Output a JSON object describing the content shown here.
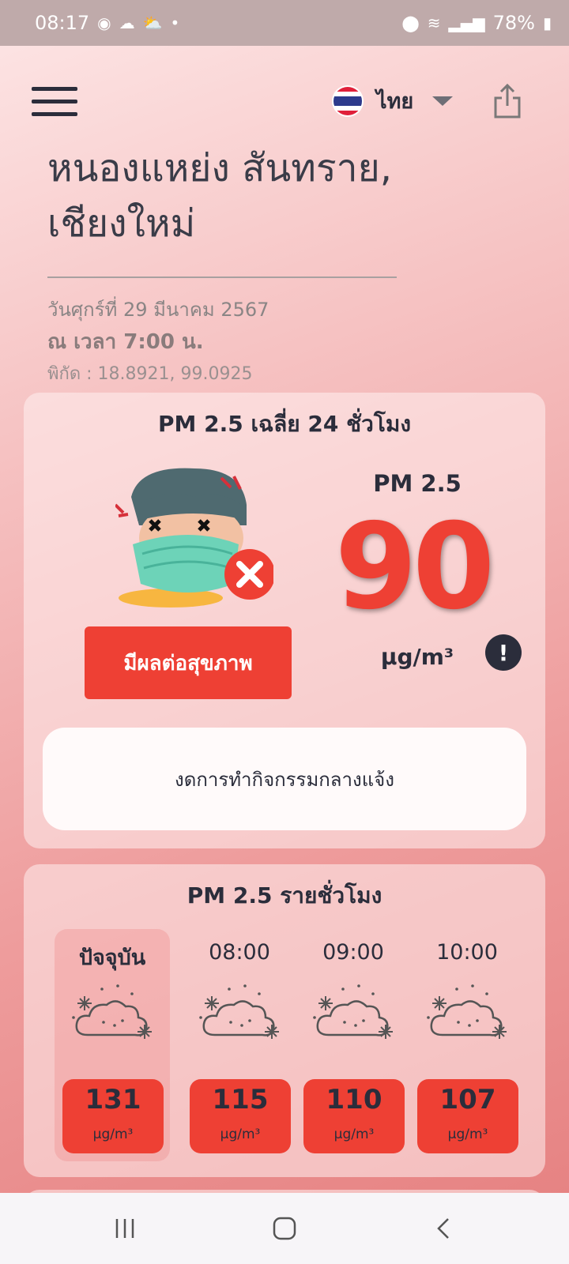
{
  "status_bar": {
    "time": "08:17",
    "battery": "78%"
  },
  "header": {
    "language_label": "ไทย"
  },
  "location": {
    "name_line1": "หนองแหย่ง สันทราย,",
    "name_line2": "เชียงใหม่",
    "date": "วันศุกร์ที่ 29 มีนาคม 2567",
    "time": "ณ เวลา 7:00 น.",
    "coordinates": "พิกัด : 18.8921, 99.0925"
  },
  "daily": {
    "title": "PM 2.5 เฉลี่ย 24 ชั่วโมง",
    "pm_label": "PM 2.5",
    "value": "90",
    "unit": "μg/m³",
    "status_label": "มีผลต่อสุขภาพ",
    "info_label": "!",
    "advice": "งดการทำกิจกรรมกลางแจ้ง"
  },
  "hourly": {
    "title": "PM 2.5 รายชั่วโมง",
    "items": [
      {
        "time": "ปัจจุบัน",
        "value": "131",
        "unit": "μg/m³"
      },
      {
        "time": "08:00",
        "value": "115",
        "unit": "μg/m³"
      },
      {
        "time": "09:00",
        "value": "110",
        "unit": "μg/m³"
      },
      {
        "time": "10:00",
        "value": "107",
        "unit": "μg/m³"
      }
    ]
  },
  "colors": {
    "status_red": "#ee4034",
    "text_dark": "#2b2d3b",
    "flag_red": "#e0203a",
    "flag_blue": "#2d3a8c"
  },
  "icons": {
    "menu": "hamburger-menu-icon",
    "share": "share-icon",
    "hourly": "dust-cloud-icon",
    "mascot": "sick-face-mask-icon"
  }
}
